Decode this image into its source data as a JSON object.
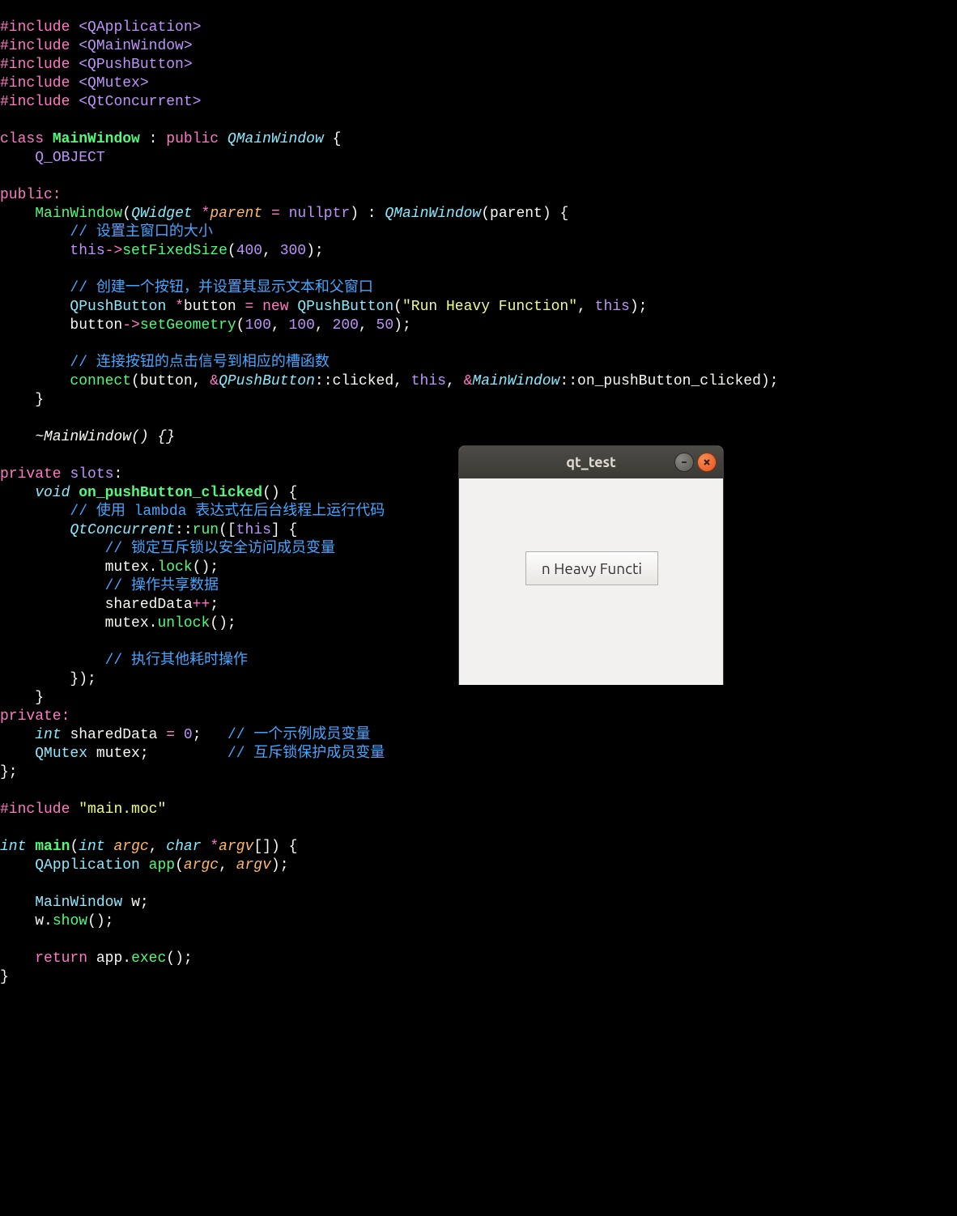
{
  "code": {
    "includes": [
      "<QApplication>",
      "<QMainWindow>",
      "<QPushButton>",
      "<QMutex>",
      "<QtConcurrent>"
    ],
    "moc_include": "\"main.moc\"",
    "class_name": "MainWindow",
    "base_class": "QMainWindow",
    "q_object": "Q_OBJECT",
    "kw_class": "class",
    "kw_public": "public",
    "kw_public_colon": "public:",
    "kw_private": "private",
    "kw_private_colon": "private:",
    "kw_slots": "slots",
    "kw_void": "void",
    "kw_int": "int",
    "kw_char": "char",
    "kw_this": "this",
    "kw_new": "new",
    "kw_nullptr": "nullptr",
    "kw_return": "return",
    "kw_include": "#include",
    "ctor_param_type": "QWidget",
    "ctor_param_name": "parent",
    "comment_size": "// 设置主窗口的大小",
    "comment_button": "// 创建一个按钮，并设置其显示文本和父窗口",
    "comment_connect": "// 连接按钮的点击信号到相应的槽函数",
    "comment_lambda": "// 使用 lambda 表达式在后台线程上运行代码",
    "comment_lock": "// 锁定互斥锁以安全访问成员变量",
    "comment_shared": "// 操作共享数据",
    "comment_heavy": "// 执行其他耗时操作",
    "comment_member": "// 一个示例成员变量",
    "comment_mutex": "// 互斥锁保护成员变量",
    "setFixedSize": "setFixedSize",
    "size_w": "400",
    "size_h": "300",
    "btn_type": "QPushButton",
    "btn_var": "button",
    "btn_text": "\"Run Heavy Function\"",
    "setGeometry": "setGeometry",
    "geom": [
      "100",
      "100",
      "200",
      "50"
    ],
    "connect": "connect",
    "signal_ns": "QPushButton",
    "signal": "clicked",
    "slot_ns": "MainWindow",
    "slot": "on_pushButton_clicked",
    "dtor": "~MainWindow",
    "qtconcurrent_ns": "QtConcurrent",
    "run_fn": "run",
    "mutex_var": "mutex",
    "lock_fn": "lock",
    "unlock_fn": "unlock",
    "shared_var": "sharedData",
    "shared_init": "0",
    "mutex_type": "QMutex",
    "main_fn": "main",
    "argc": "argc",
    "argv": "argv",
    "app_type": "QApplication",
    "app_var": "app",
    "w_var": "w",
    "show_fn": "show",
    "exec_fn": "exec"
  },
  "qt_window": {
    "title": "qt_test",
    "button_label": "n Heavy Functi"
  }
}
